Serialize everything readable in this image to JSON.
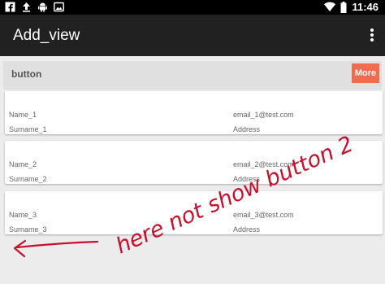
{
  "status_bar": {
    "icons": [
      "facebook-icon",
      "upload-icon",
      "android-icon",
      "photo-icon",
      "wifi-icon",
      "battery-icon"
    ],
    "time": "11:46"
  },
  "app_bar": {
    "title": "Add_view",
    "menu_icon": "overflow-menu-icon"
  },
  "header": {
    "label": "button",
    "more_label": "More",
    "more_color": "#f26b4c"
  },
  "items": [
    {
      "name": "Name_1",
      "surname": "Surname_1",
      "email": "email_1@test.com",
      "address": "Address"
    },
    {
      "name": "Name_2",
      "surname": "Surname_2",
      "email": "email_2@test.com",
      "address": "Address"
    },
    {
      "name": "Name_3",
      "surname": "Surname_3",
      "email": "email_3@test.com",
      "address": "Address"
    }
  ],
  "annotation": {
    "text": "here not show button 2",
    "color": "#c8102e"
  }
}
